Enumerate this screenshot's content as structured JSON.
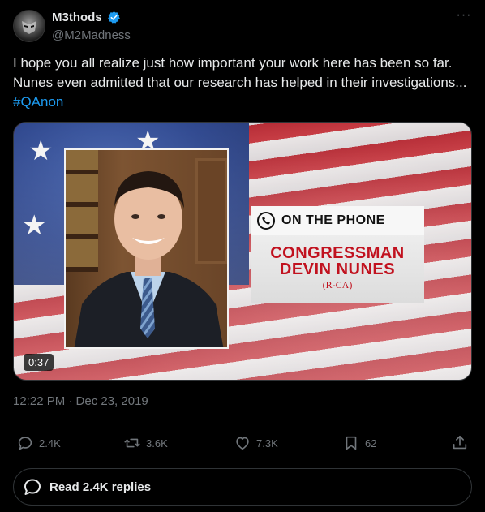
{
  "author": {
    "display_name": "M3thods",
    "handle": "@M2Madness",
    "verified": true,
    "avatar_icon": "avatar-mask-icon"
  },
  "tweet": {
    "text": "I hope you all realize just how important your work here has been so far. Nunes even admitted that our research has helped in their investigations... ",
    "hashtag": "#QAnon"
  },
  "media": {
    "phone_label": "ON THE PHONE",
    "name_line1": "CONGRESSMAN",
    "name_line2": "DEVIN NUNES",
    "party": "(R-CA)",
    "duration": "0:37"
  },
  "timestamp": "12:22 PM · Dec 23, 2019",
  "actions": {
    "replies": "2.4K",
    "reposts": "3.6K",
    "likes": "7.3K",
    "bookmarks": "62"
  },
  "read_replies_label": "Read 2.4K replies",
  "colors": {
    "accent": "#1d9bf0",
    "muted": "#71767b",
    "text": "#e7e9ea",
    "background": "#000000"
  }
}
